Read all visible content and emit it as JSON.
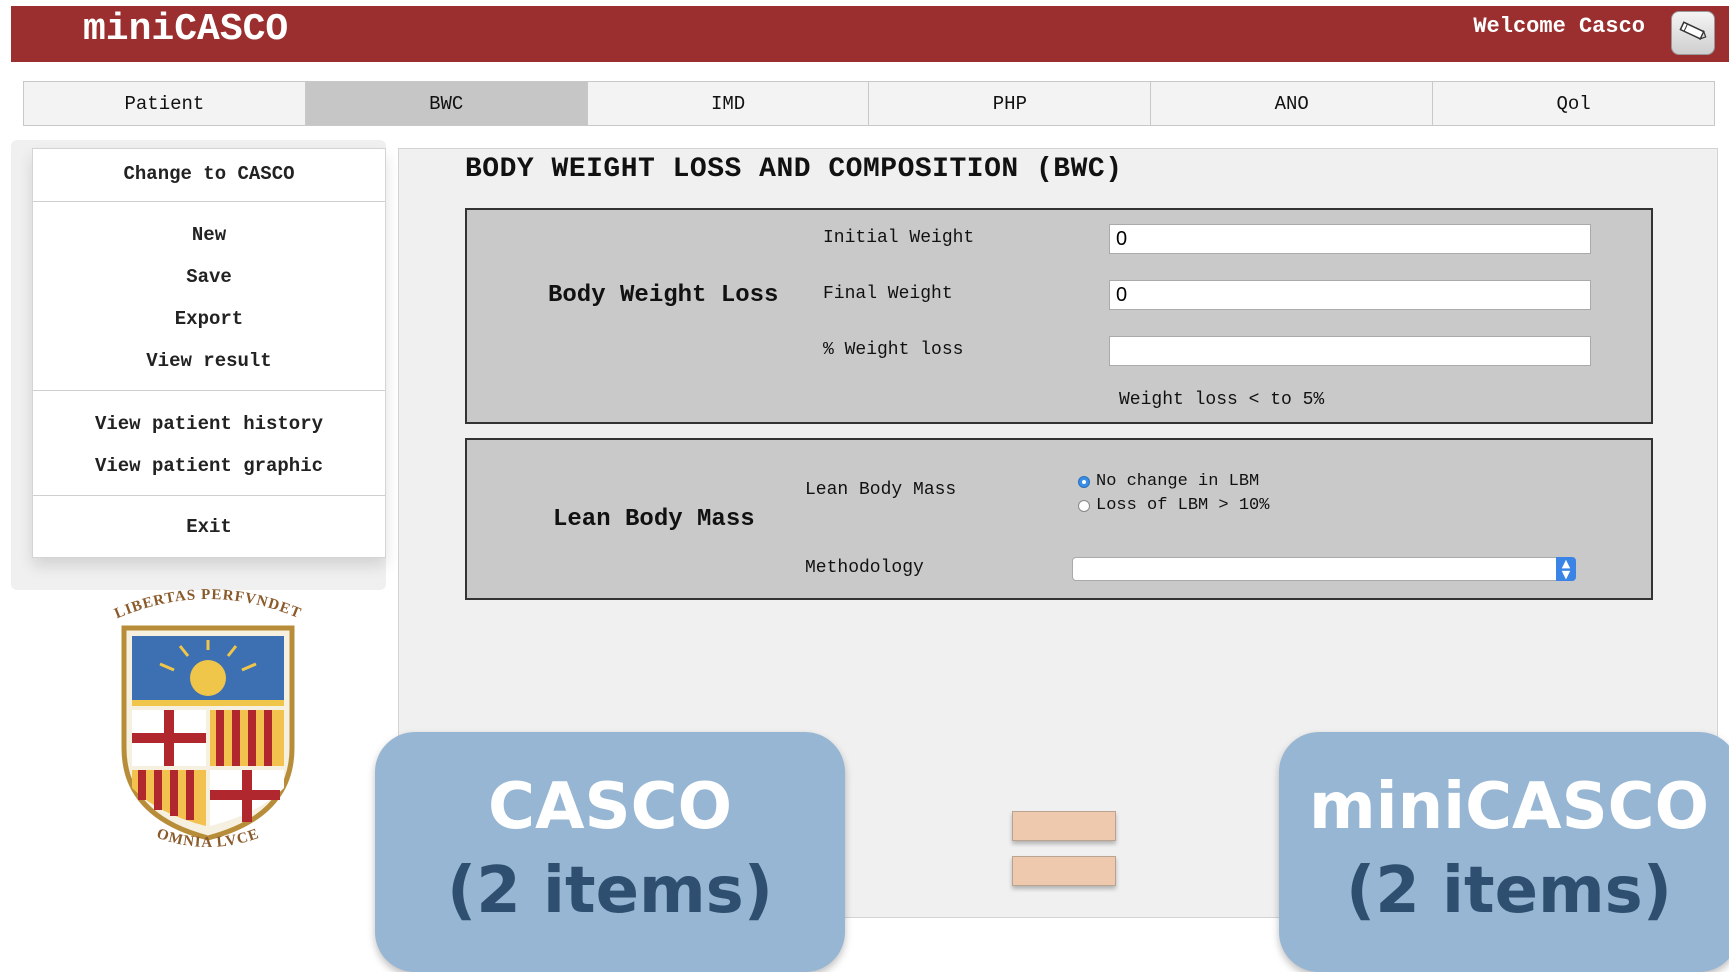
{
  "header": {
    "app_title": "miniCASCO",
    "welcome_text": "Welcome Casco",
    "edit_icon": "pencil-icon"
  },
  "tabs": [
    {
      "label": "Patient",
      "active": false
    },
    {
      "label": "BWC",
      "active": true
    },
    {
      "label": "IMD",
      "active": false
    },
    {
      "label": "PHP",
      "active": false
    },
    {
      "label": "ANO",
      "active": false
    },
    {
      "label": "Qol",
      "active": false
    }
  ],
  "sidebar": {
    "change_label": "Change to CASCO",
    "new_label": "New",
    "save_label": "Save",
    "export_label": "Export",
    "view_result_label": "View result",
    "history_label": "View patient history",
    "graphic_label": "View patient graphic",
    "exit_label": "Exit"
  },
  "crest": {
    "top_motto": "LIBERTAS PERFVNDET",
    "bottom_motto": "OMNIA LVCE"
  },
  "main": {
    "section_title": "BODY WEIGHT LOSS AND COMPOSITION (BWC)",
    "bwl": {
      "title": "Body Weight Loss",
      "initial_label": "Initial Weight",
      "initial_value": "0",
      "final_label": "Final Weight",
      "final_value": "0",
      "pct_label": "% Weight loss",
      "pct_value": "",
      "note": "Weight loss < to 5%"
    },
    "lbm": {
      "title": "Lean Body Mass",
      "lbm_label": "Lean Body Mass",
      "option1": "No change in LBM",
      "option2": "Loss of LBM > 10%",
      "selected": "No change in LBM",
      "methodology_label": "Methodology",
      "methodology_value": ""
    }
  },
  "overlay": {
    "left_line1": "CASCO",
    "left_line2": "(2 items)",
    "right_line1": "miniCASCO",
    "right_line2": "(2 items)",
    "equals_color": "#efc9ae",
    "box_color": "#97b6d3"
  }
}
